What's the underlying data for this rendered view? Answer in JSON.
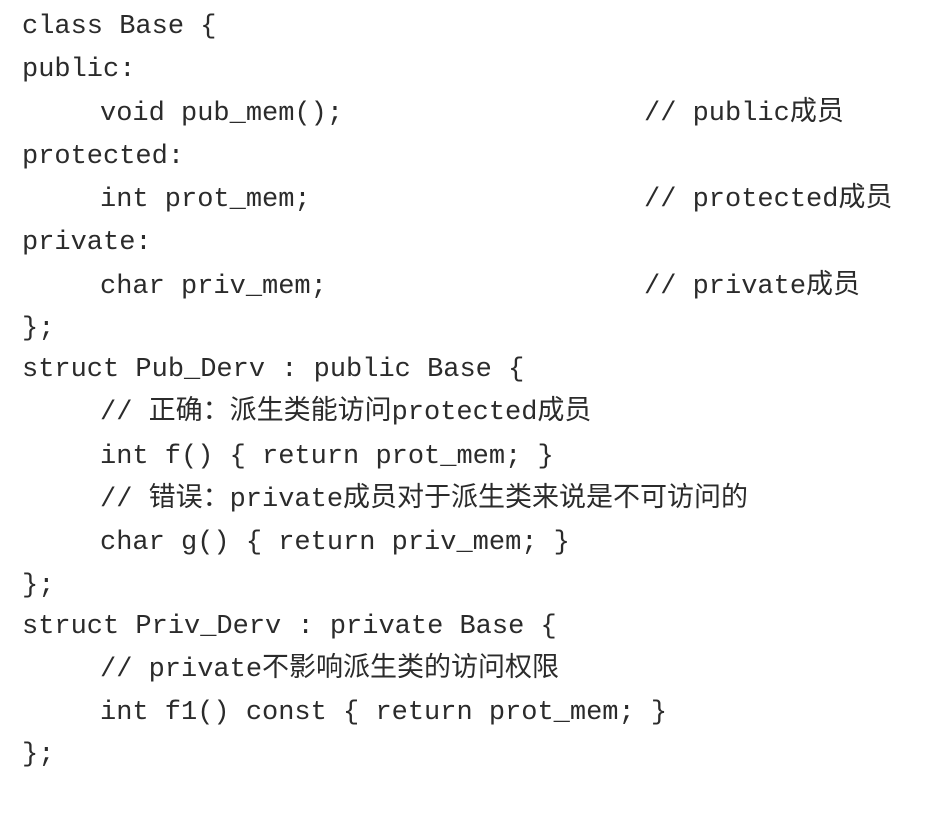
{
  "code": {
    "lines": [
      {
        "text": "class Base {"
      },
      {
        "text": "public:"
      },
      {
        "text": "void pub_mem();",
        "comment": "// public成员"
      },
      {
        "text": "protected:"
      },
      {
        "text": "int prot_mem;",
        "comment": "// protected成员"
      },
      {
        "text": "private:"
      },
      {
        "text": "char priv_mem;",
        "comment": "// private成员"
      },
      {
        "text": "};"
      },
      {
        "text": "struct Pub_Derv : public Base {"
      },
      {
        "text": "// 正确：派生类能访问protected成员"
      },
      {
        "text": "int f() { return prot_mem; }"
      },
      {
        "text": "// 错误：private成员对于派生类来说是不可访问的"
      },
      {
        "text": "char g() { return priv_mem; }"
      },
      {
        "text": "};"
      },
      {
        "text": "struct Priv_Derv : private Base {"
      },
      {
        "text": "// private不影响派生类的访问权限"
      },
      {
        "text": "int f1() const { return prot_mem; }"
      },
      {
        "text": "};"
      }
    ]
  }
}
